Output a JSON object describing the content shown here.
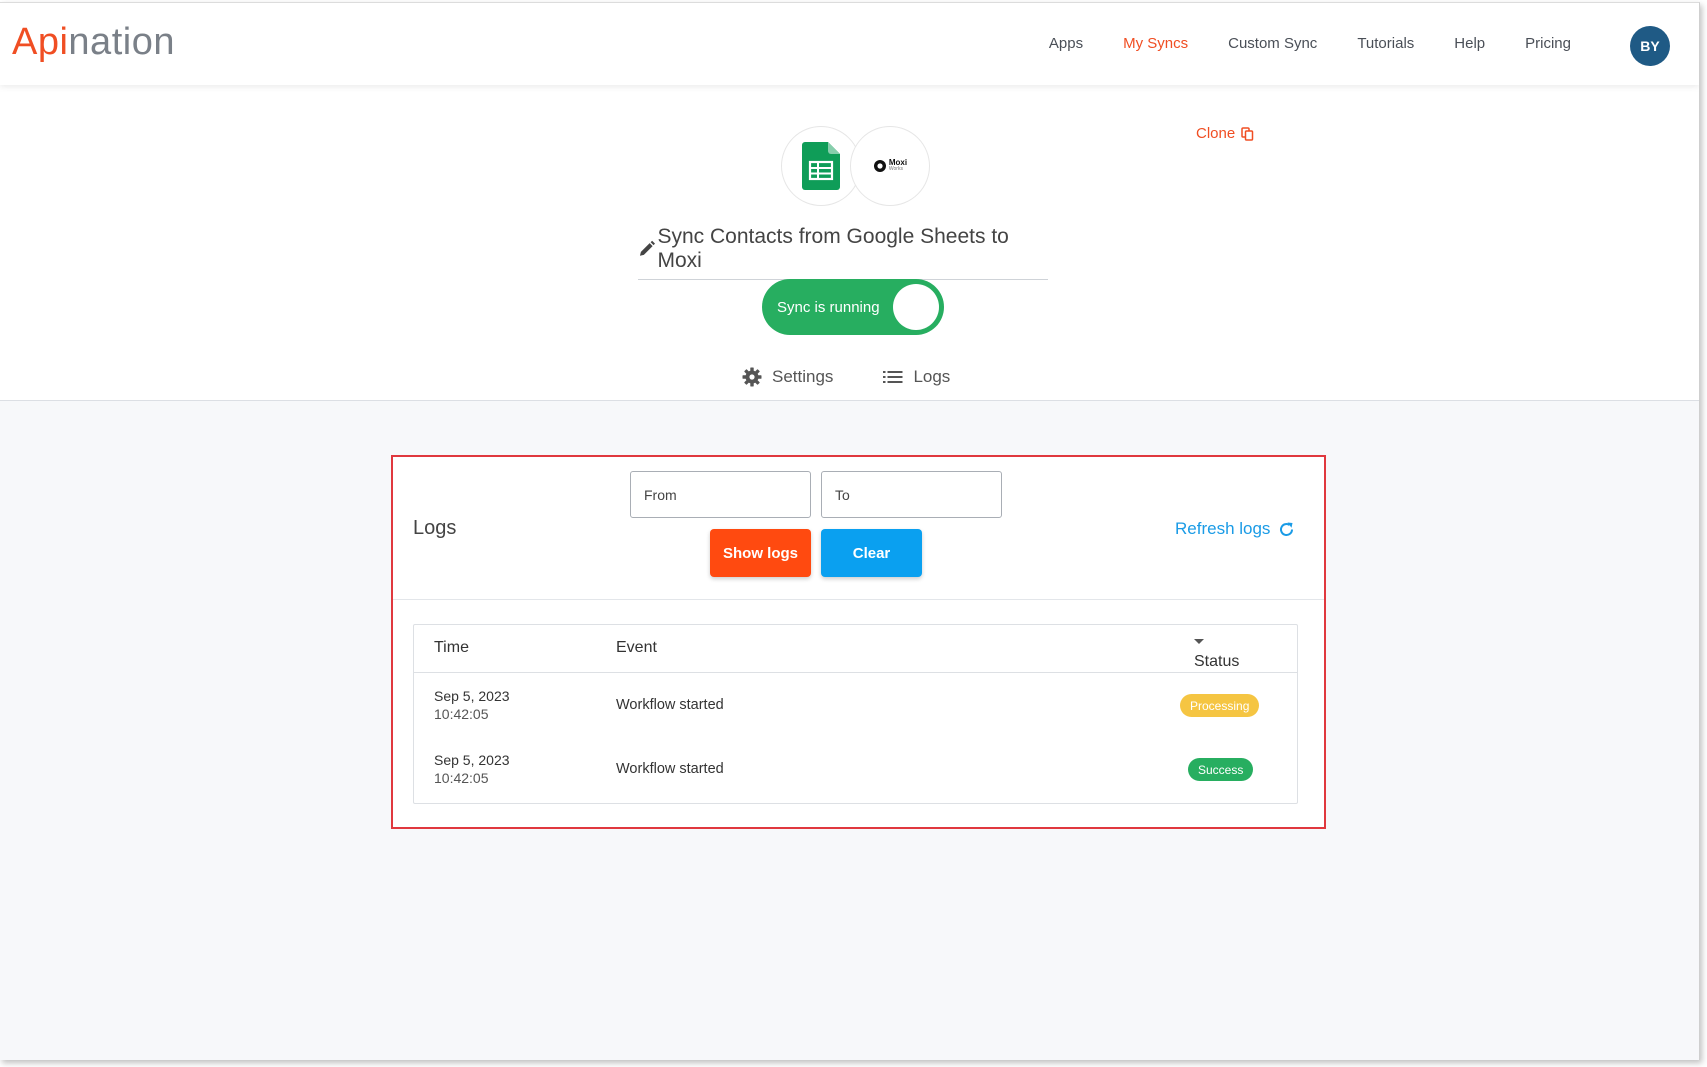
{
  "brand": {
    "part1": "Api",
    "part2": "nation"
  },
  "nav": {
    "items": [
      "Apps",
      "My Syncs",
      "Custom Sync",
      "Tutorials",
      "Help",
      "Pricing"
    ],
    "active": "My Syncs",
    "avatar": "BY"
  },
  "hero": {
    "clone_label": "Clone",
    "app1_icon": "google-sheets-icon",
    "app2_logo_text": "Moxi",
    "app2_logo_sub": "Works",
    "title": "Sync Contacts from Google Sheets to Moxi",
    "toggle_label": "Sync is running",
    "toggle_on": true,
    "tabs": [
      "Settings",
      "Logs"
    ]
  },
  "logs": {
    "title": "Logs",
    "from_placeholder": "From",
    "to_placeholder": "To",
    "show_button": "Show logs",
    "clear_button": "Clear",
    "refresh_label": "Refresh logs",
    "columns": [
      "Time",
      "Event",
      "Status"
    ],
    "rows": [
      {
        "date": "Sep 5, 2023",
        "time": "10:42:05",
        "event": "Workflow started",
        "status": "Processing"
      },
      {
        "date": "Sep 5, 2023",
        "time": "10:42:05",
        "event": "Workflow started",
        "status": "Success"
      }
    ]
  },
  "colors": {
    "accent": "#f04e23",
    "running": "#27ae60",
    "link": "#1a9be6",
    "processing": "#f5c542",
    "success": "#27ae60"
  }
}
